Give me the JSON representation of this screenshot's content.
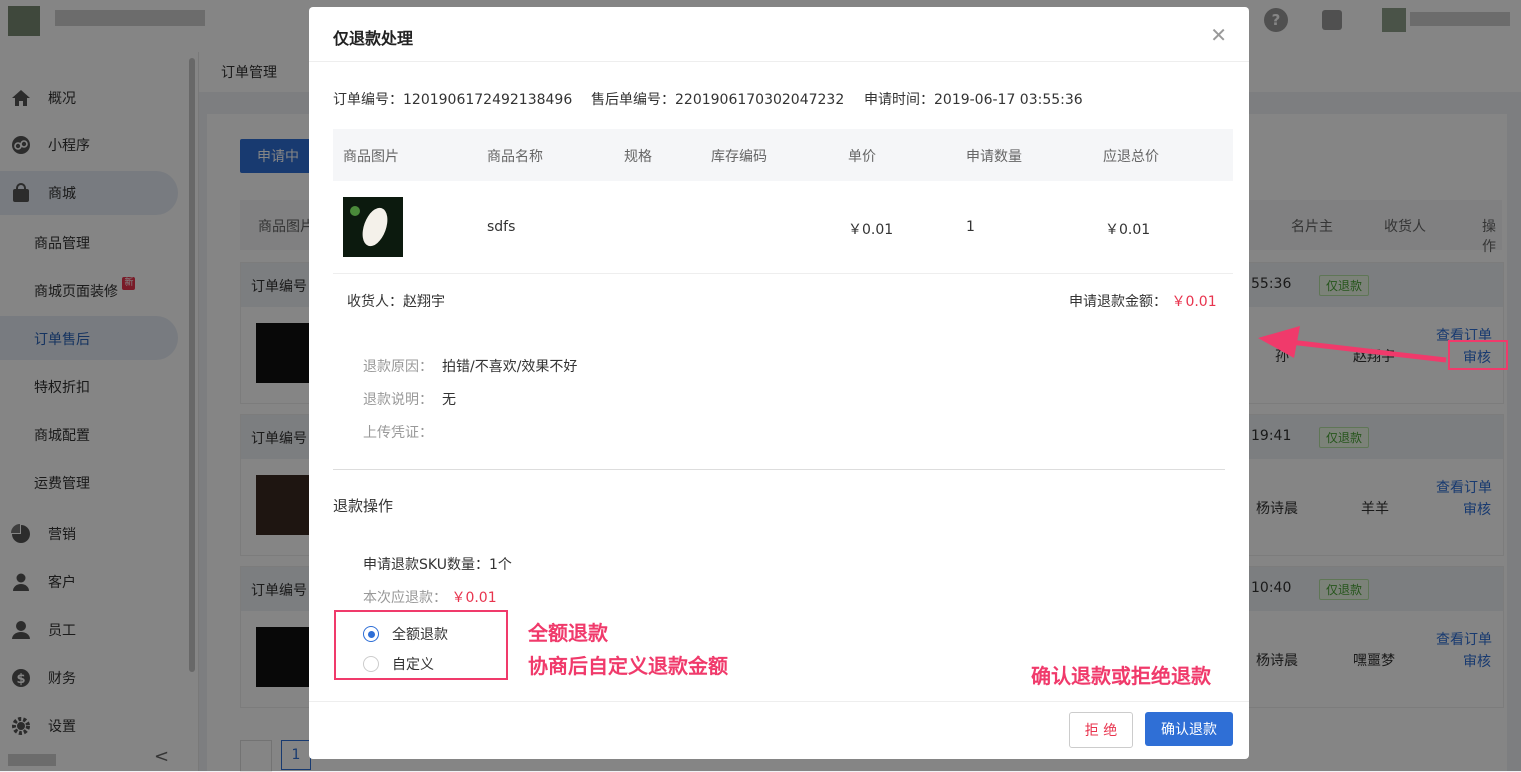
{
  "sidebar": {
    "items": [
      {
        "label": "概况",
        "icon": "home-icon"
      },
      {
        "label": "小程序",
        "icon": "miniprogram-icon"
      },
      {
        "label": "商城",
        "icon": "bag-icon"
      }
    ],
    "sub": [
      "商品管理",
      "商城页面装修",
      "订单售后",
      "特权折扣",
      "商城配置",
      "运费管理"
    ],
    "new_badge": "新",
    "items2": [
      {
        "label": "营销",
        "icon": "pie-icon"
      },
      {
        "label": "客户",
        "icon": "user-icon"
      },
      {
        "label": "员工",
        "icon": "staff-icon"
      },
      {
        "label": "财务",
        "icon": "dollar-icon"
      },
      {
        "label": "设置",
        "icon": "gear-icon"
      }
    ],
    "collapse": "<"
  },
  "page": {
    "breadcrumb": "订单管理",
    "tab": "申请中",
    "col_img": "商品图片",
    "col_card_owner": "名片主",
    "col_receiver": "收货人",
    "col_op": "操作",
    "order_label": "订单编号",
    "rows": [
      {
        "time": "55:36",
        "tag": "仅退款",
        "owner": "孙",
        "receiver": "赵翔宇",
        "view": "查看订单",
        "audit": "审核"
      },
      {
        "time": "19:41",
        "tag": "仅退款",
        "owner": "杨诗晨",
        "receiver": "羊羊",
        "view": "查看订单",
        "audit": "审核"
      },
      {
        "time": "10:40",
        "tag": "仅退款",
        "owner": "杨诗晨",
        "receiver": "嘿噩梦",
        "view": "查看订单",
        "audit": "审核"
      }
    ],
    "pager": "1"
  },
  "modal": {
    "title": "仅退款处理",
    "order_no": "订单编号：1201906172492138496",
    "after_sale_no": "售后单编号：2201906170302047232",
    "apply_time": "申请时间：2019-06-17 03:55:36",
    "headers": [
      "商品图片",
      "商品名称",
      "规格",
      "库存编码",
      "单价",
      "申请数量",
      "应退总价"
    ],
    "item": {
      "name": "sdfs",
      "price": "￥0.01",
      "qty": "1",
      "total": "￥0.01"
    },
    "receiver": "收货人：赵翔宇",
    "refund_amount_label": "申请退款金额：",
    "refund_amount": "￥0.01",
    "reason_label": "退款原因：",
    "reason": "拍错/不喜欢/效果不好",
    "desc_label": "退款说明：",
    "desc": "无",
    "upload_label": "上传凭证：",
    "op_title": "退款操作",
    "sku_count": "申请退款SKU数量：1个",
    "should_refund_label": "本次应退款：",
    "should_refund": "￥0.01",
    "opt_full": "全额退款",
    "opt_custom": "自定义",
    "reject": "拒 绝",
    "confirm": "确认退款"
  },
  "annotations": {
    "full": "全额退款",
    "custom": "协商后自定义退款金额",
    "buttons": "确认退款或拒绝退款"
  },
  "colors": {
    "accent": "#2f6fd6",
    "red": "#e8344e",
    "annotation": "#f03a6b"
  }
}
